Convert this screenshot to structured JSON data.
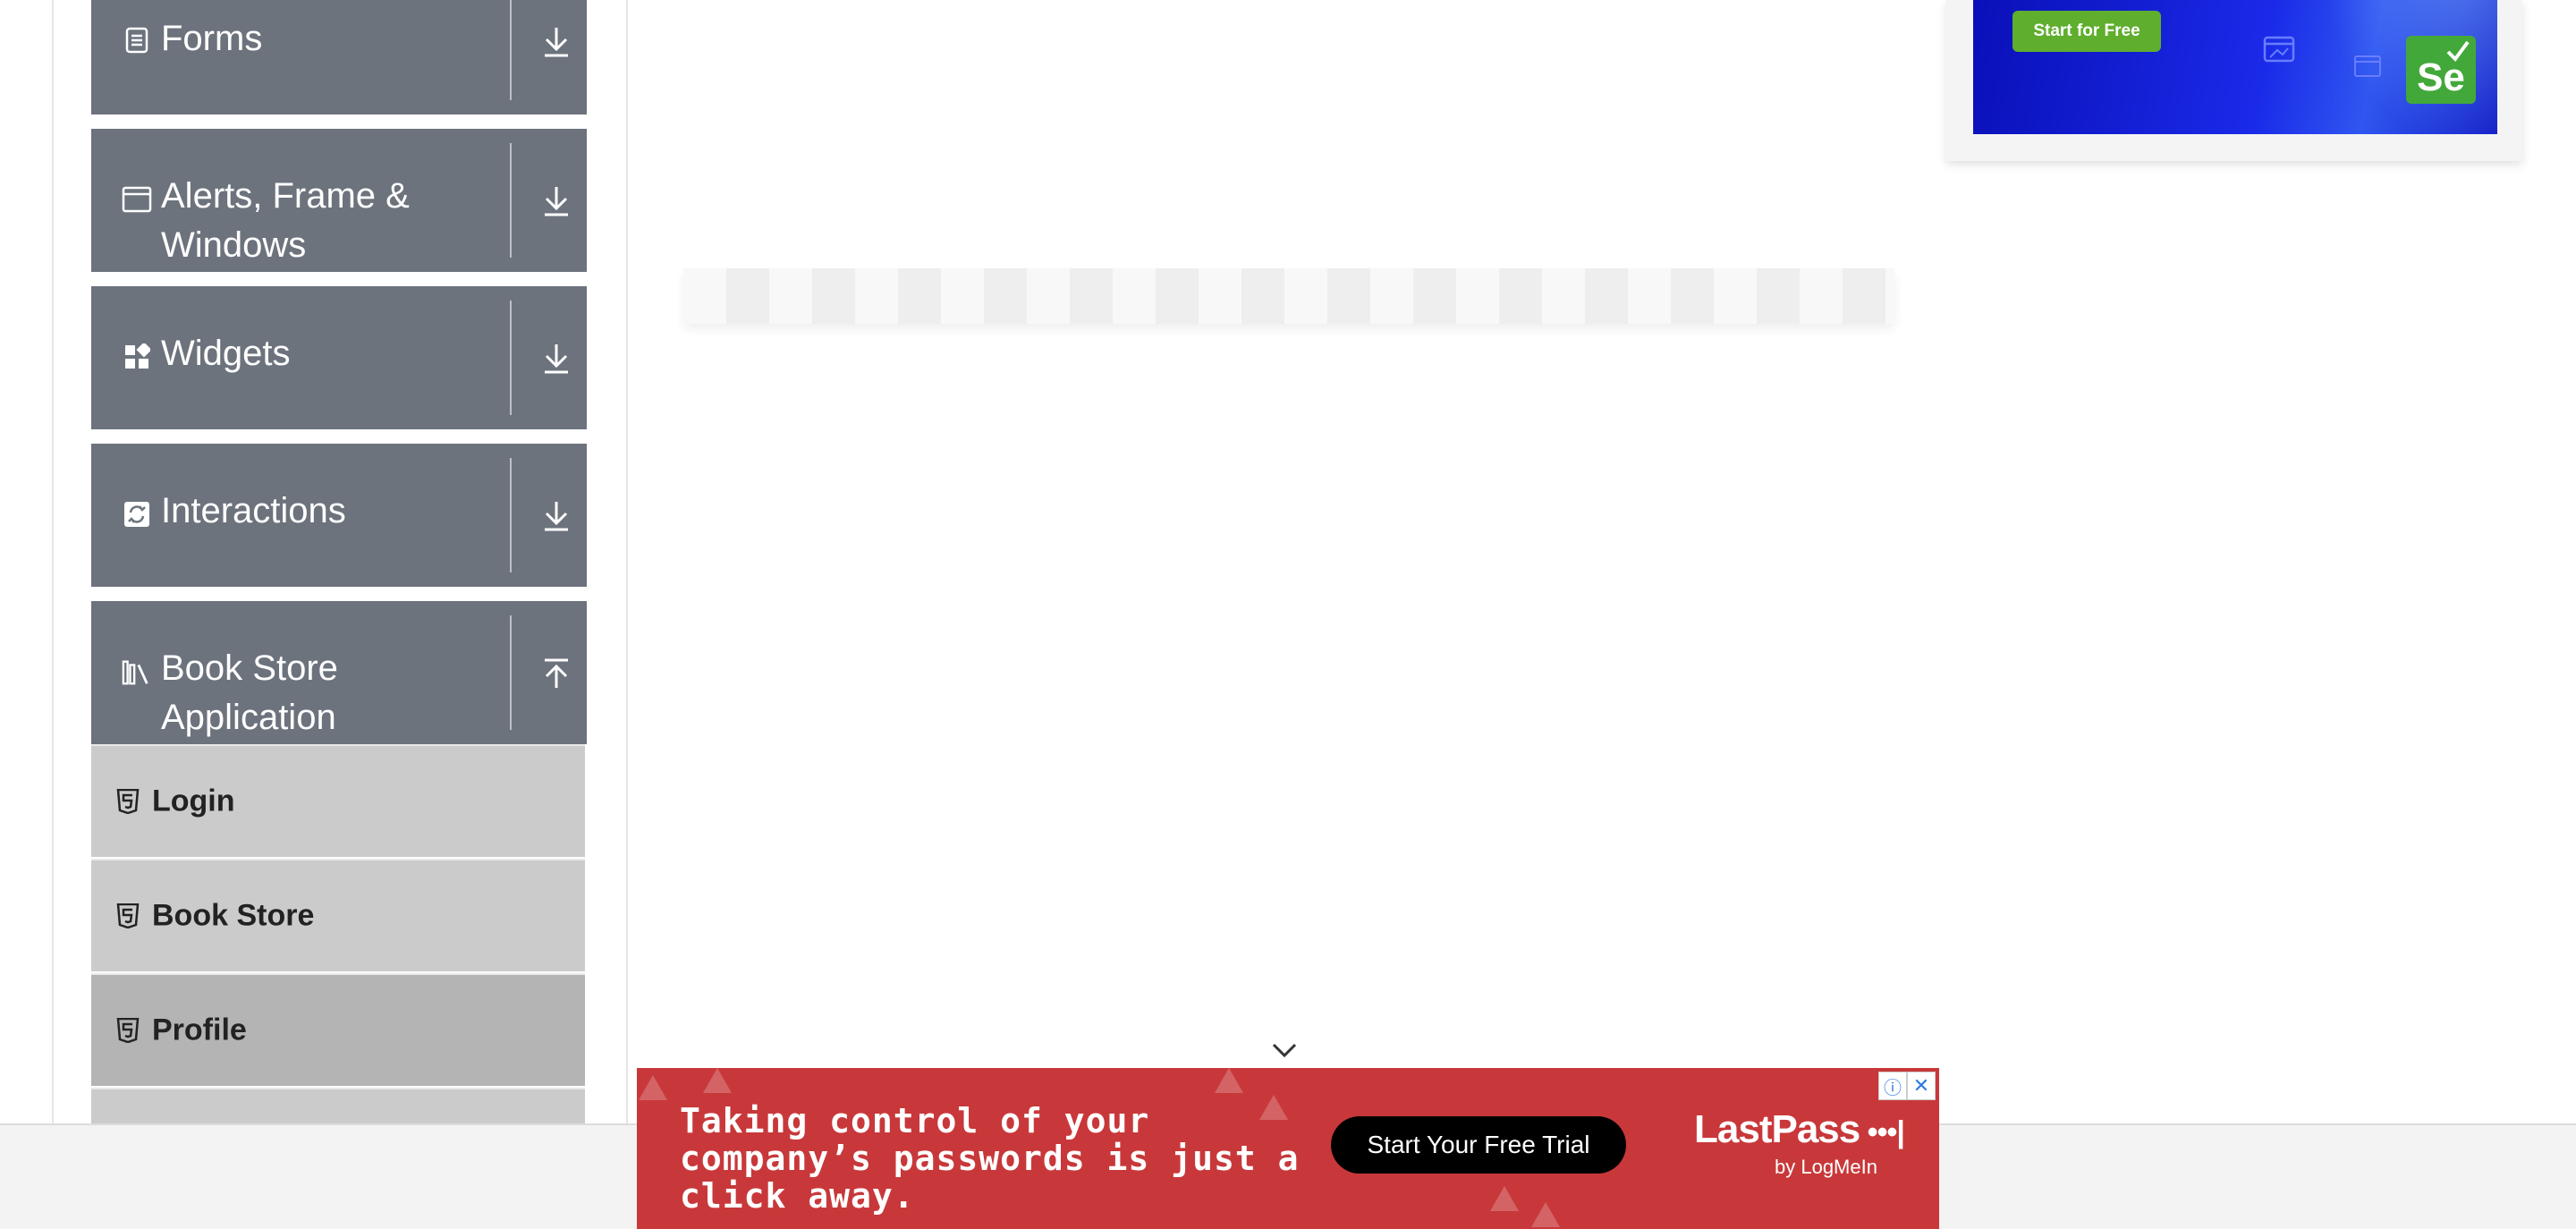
{
  "sidebar": {
    "groups": [
      {
        "label": "Forms",
        "icon": "document-icon",
        "state": "collapsed"
      },
      {
        "label": "Alerts, Frame & Windows",
        "icon": "window-icon",
        "state": "collapsed"
      },
      {
        "label": "Widgets",
        "icon": "widgets-icon",
        "state": "collapsed"
      },
      {
        "label": "Interactions",
        "icon": "interactions-icon",
        "state": "collapsed"
      },
      {
        "label": "Book Store Application",
        "icon": "books-icon",
        "state": "expanded"
      }
    ],
    "book_store_items": [
      {
        "label": "Login",
        "icon": "html5-icon"
      },
      {
        "label": "Book Store",
        "icon": "html5-icon"
      },
      {
        "label": "Profile",
        "icon": "html5-icon",
        "active": true
      }
    ]
  },
  "ads": {
    "top": {
      "cta": "Start for Free",
      "badge": "Se",
      "color": "#1a2ae8"
    },
    "bottom": {
      "headline": "Taking control of your company’s passwords is just a click away.",
      "cta": "Start Your Free Trial",
      "brand": "LastPass",
      "brand_sub": "by LogMeIn",
      "info_icon": "info-icon",
      "close_icon": "close-icon",
      "color": "#c8383a"
    }
  },
  "colors": {
    "sidebar_group_bg": "#6c737d",
    "sub_item_bg": "#cbcbcb",
    "sub_item_active_bg": "#b4b4b4"
  }
}
